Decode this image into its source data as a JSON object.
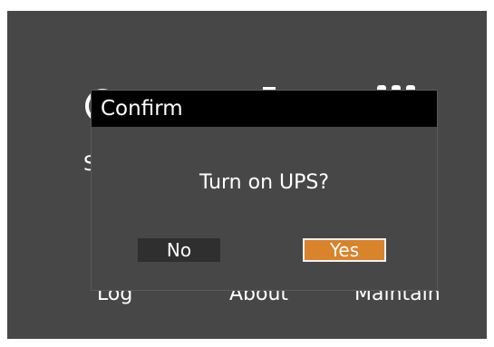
{
  "background_menu": {
    "labels": {
      "status": "S",
      "log": "Log",
      "about": "About",
      "maintain": "Maintain"
    },
    "icons": [
      "power-icon",
      "ups-tower-icon",
      "battery-dots-icon"
    ]
  },
  "dialog": {
    "title": "Confirm",
    "message": "Turn on UPS?",
    "buttons": {
      "no": "No",
      "yes": "Yes"
    }
  },
  "colors": {
    "screen_background": "#474747",
    "title_bar": "#000000",
    "no_button": "#2f2f2f",
    "yes_button_selected": "#d9832a",
    "text": "#ffffff"
  }
}
